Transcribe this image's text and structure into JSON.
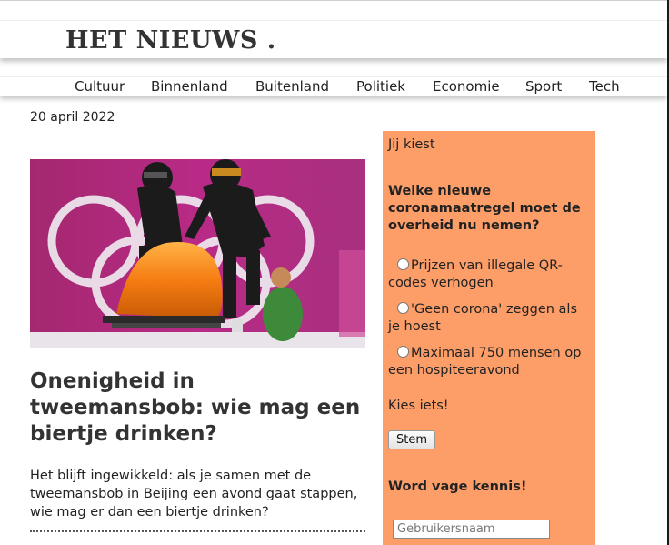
{
  "site": {
    "logo": "HET NIEUWS ."
  },
  "nav": {
    "items": [
      "Cultuur",
      "Binnenland",
      "Buitenland",
      "Politiek",
      "Economie",
      "Sport",
      "Tech"
    ]
  },
  "article": {
    "date": "20 april 2022",
    "headline": "Onenigheid in tweemansbob: wie mag een biertje drinken?",
    "lead": "Het blijft ingewikkeld: als je samen met de tweemansbob in Beijing een avond gaat stappen, wie mag er dan een biertje drinken?"
  },
  "poll": {
    "kicker": "Jij kiest",
    "question": "Welke nieuwe coronamaatregel moet de overheid nu nemen?",
    "options": [
      "Prijzen van illegale QR-codes verhogen",
      "'Geen corona' zeggen als je hoest",
      "Maximaal 750 mensen op een hospiteeravond"
    ],
    "hint": "Kies iets!",
    "submit_label": "Stem"
  },
  "login": {
    "title": "Word vage kennis!",
    "username_placeholder": "Gebruikersnaam"
  },
  "colors": {
    "poll_bg": "#fd9e69",
    "hero_bg": "#b0267f",
    "bobsled": "#f57c12"
  }
}
